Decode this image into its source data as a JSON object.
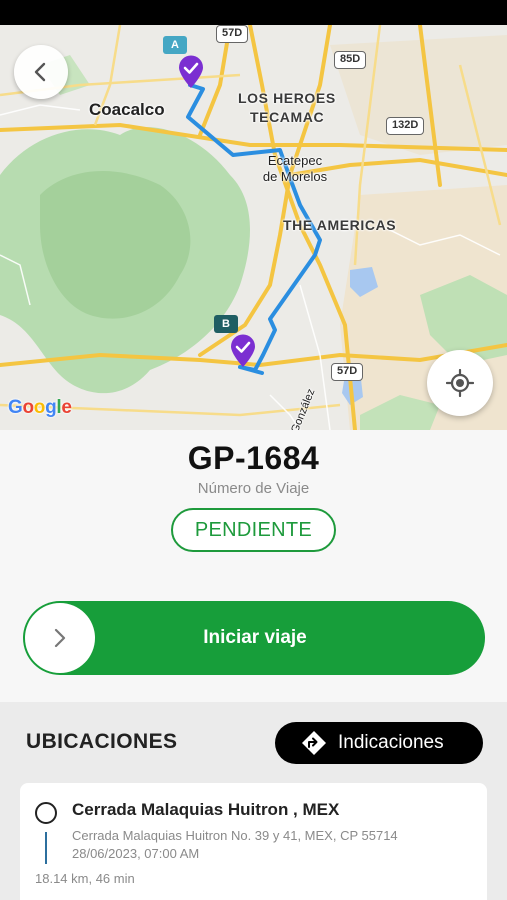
{
  "colors": {
    "accent_green": "#179e3a",
    "route_blue": "#2b8ee0",
    "pin_purple": "#7b2fd1",
    "marker_a": "#45a7c4",
    "marker_b": "#1f5e63"
  },
  "map": {
    "labels": {
      "coacalco": "Coacalco",
      "los_heroes": "LOS HEROES",
      "tecamac": "TECAMAC",
      "ecatepec_1": "Ecatepec",
      "ecatepec_2": "de Morelos",
      "the_americas": "THE AMERICAS",
      "gonzalez": "González"
    },
    "shields": {
      "s57d_top": "57D",
      "s85d": "85D",
      "s132d": "132D",
      "s57d_bottom": "57D"
    },
    "marker_a": "A",
    "marker_b": "B",
    "google_logo": [
      "G",
      "o",
      "o",
      "g",
      "l",
      "e"
    ],
    "icons": {
      "back": "chevron-left-icon",
      "locate": "crosshair-icon",
      "pin": "check-pin-icon"
    }
  },
  "trip": {
    "number": "GP-1684",
    "subtitle": "Número de Viaje",
    "status": "PENDIENTE",
    "start_label": "Iniciar viaje"
  },
  "locations": {
    "title": "UBICACIONES",
    "directions_label": "Indicaciones",
    "items": [
      {
        "title": "Cerrada Malaquias Huitron , MEX",
        "address": "Cerrada Malaquias Huitron  No. 39 y 41, MEX, CP 55714",
        "datetime": "28/06/2023, 07:00 AM",
        "distance": "18.14 km, 46 min"
      }
    ]
  }
}
